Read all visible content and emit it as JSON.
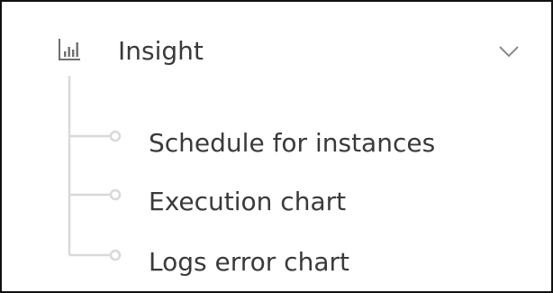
{
  "menu": {
    "title": "Insight",
    "icon": "bar-chart-icon",
    "expanded": true,
    "expand_icon": "chevron-down-icon",
    "items": [
      {
        "label": "Schedule for instances"
      },
      {
        "label": "Execution chart"
      },
      {
        "label": "Logs error chart"
      }
    ]
  },
  "colors": {
    "text": "#3a3a3a",
    "icon": "#6f6f6f",
    "tree_line": "#d9d9d9",
    "border": "#111111",
    "background": "#ffffff"
  }
}
